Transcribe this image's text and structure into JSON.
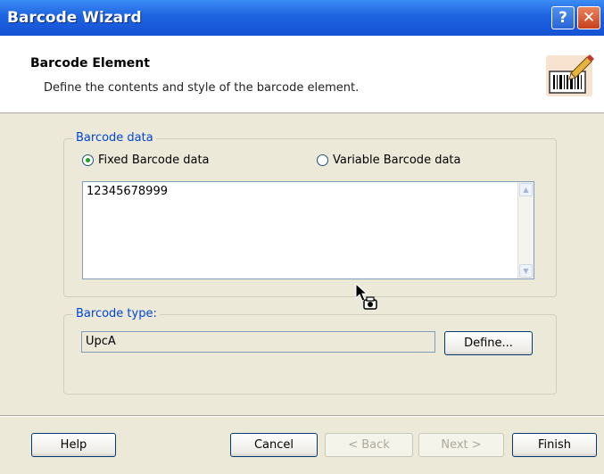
{
  "window": {
    "title": "Barcode Wizard",
    "help_glyph": "?",
    "close_glyph": "✕"
  },
  "header": {
    "title": "Barcode Element",
    "subtitle": "Define the contents and style of the barcode element.",
    "icon": "barcode-pen-icon"
  },
  "barcode_data": {
    "group_label": "Barcode data",
    "fixed_label": "Fixed Barcode data",
    "variable_label": "Variable Barcode data",
    "selected": "fixed",
    "value": "12345678999"
  },
  "barcode_type": {
    "group_label": "Barcode type:",
    "value": "UpcA",
    "define_label": "Define..."
  },
  "buttons": {
    "help": "Help",
    "cancel": "Cancel",
    "back": "< Back",
    "next": "Next >",
    "finish": "Finish"
  },
  "colors": {
    "title_bar": "#1d63e0",
    "dialog_bg": "#ece9d8",
    "group_label": "#0046d5"
  }
}
